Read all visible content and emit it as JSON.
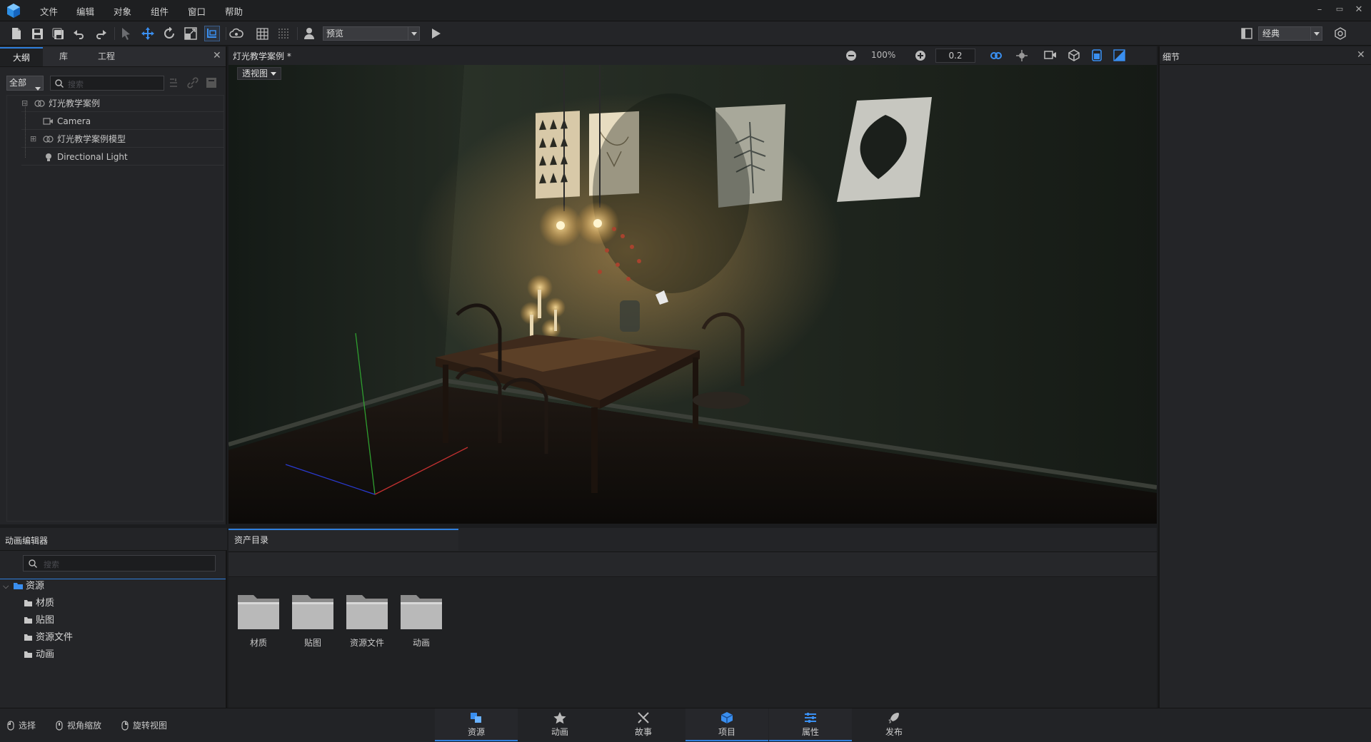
{
  "menubar": {
    "items": [
      "文件",
      "编辑",
      "对象",
      "组件",
      "窗口",
      "帮助"
    ],
    "window_controls": [
      "–",
      "▭",
      "✕"
    ]
  },
  "toolbar": {
    "preview_mode": "预览",
    "layout_mode": "经典"
  },
  "outline_panel": {
    "tabs": [
      "大纲",
      "库",
      "工程"
    ],
    "active_tab": "大纲",
    "filter_value": "全部",
    "search_placeholder": "搜索",
    "tree": [
      {
        "label": "灯光教学案例",
        "icon": "scene-icon",
        "expander": "⊟"
      },
      {
        "label": "Camera",
        "icon": "camera-icon",
        "expander": ""
      },
      {
        "label": "灯光教学案例模型",
        "icon": "model-icon",
        "expander": "⊞"
      },
      {
        "label": "Directional Light",
        "icon": "light-icon",
        "expander": ""
      }
    ]
  },
  "viewport": {
    "tab_title": "灯光教学案例 *",
    "view_mode": "透视图",
    "zoom": "100%",
    "step_value": "0.2"
  },
  "details_panel": {
    "title": "细节"
  },
  "animation_panel": {
    "title": "动画编辑器",
    "search_placeholder": "搜索",
    "root": "资源",
    "children": [
      "材质",
      "贴图",
      "资源文件",
      "动画"
    ]
  },
  "asset_panel": {
    "tab_title": "资产目录",
    "folders": [
      "材质",
      "贴图",
      "资源文件",
      "动画"
    ]
  },
  "statusbar": {
    "hints": [
      "选择",
      "视角缩放",
      "旋转视图"
    ]
  },
  "bottom_tabs": [
    "资源",
    "动画",
    "故事",
    "项目",
    "属性",
    "发布"
  ],
  "colors": {
    "accent": "#2f7fdc",
    "panel_bg": "#242528",
    "viewport_bg": "#0f110f"
  }
}
